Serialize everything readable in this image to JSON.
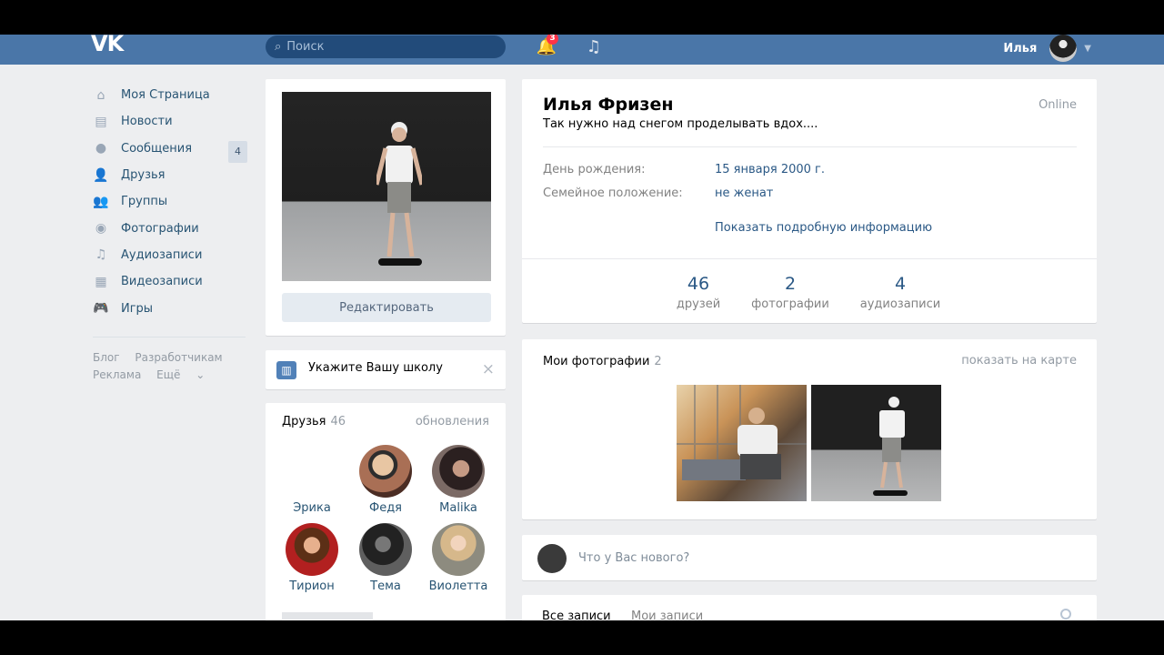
{
  "header": {
    "logo": "VK",
    "search_placeholder": "Поиск",
    "notifications_count": "3",
    "user_name": "Илья"
  },
  "sidebar": {
    "items": [
      {
        "label": "Моя Страница",
        "icon": "home-icon"
      },
      {
        "label": "Новости",
        "icon": "news-icon"
      },
      {
        "label": "Сообщения",
        "icon": "message-icon",
        "count": "4"
      },
      {
        "label": "Друзья",
        "icon": "user-icon"
      },
      {
        "label": "Группы",
        "icon": "groups-icon"
      },
      {
        "label": "Фотографии",
        "icon": "camera-icon"
      },
      {
        "label": "Аудиозаписи",
        "icon": "music-icon"
      },
      {
        "label": "Видеозаписи",
        "icon": "video-icon"
      },
      {
        "label": "Игры",
        "icon": "gamepad-icon"
      }
    ],
    "footer_links": [
      "Блог",
      "Разработчикам",
      "Реклама",
      "Ещё"
    ]
  },
  "profile": {
    "edit_label": "Редактировать",
    "school_prompt": "Укажите Вашу школу",
    "name": "Илья Фризен",
    "online": "Online",
    "status": "Так нужно над снегом проделывать вдох....",
    "birthday_label": "День рождения:",
    "birthday_value": "15 января 2000 г.",
    "family_label": "Семейное положение:",
    "family_value": "не женат",
    "more_info": "Показать подробную информацию",
    "stats": [
      {
        "value": "46",
        "label": "друзей"
      },
      {
        "value": "2",
        "label": "фотографии"
      },
      {
        "value": "4",
        "label": "аудиозаписи"
      }
    ]
  },
  "friends": {
    "title": "Друзья",
    "count": "46",
    "updates": "обновления",
    "items": [
      {
        "name": "Эрика"
      },
      {
        "name": "Федя"
      },
      {
        "name": "Malika"
      },
      {
        "name": "Тирион"
      },
      {
        "name": "Тема"
      },
      {
        "name": "Виолетта"
      }
    ]
  },
  "photos": {
    "title": "Мои фотографии",
    "count": "2",
    "map_link": "показать на карте"
  },
  "post": {
    "placeholder": "Что у Вас нового?"
  },
  "wall": {
    "tabs": [
      "Все записи",
      "Мои записи"
    ]
  }
}
